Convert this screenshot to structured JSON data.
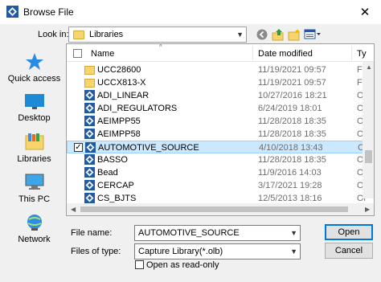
{
  "window": {
    "title": "Browse File",
    "close_glyph": "✕"
  },
  "toolbar": {
    "lookin_label": "Look in:",
    "lookin_value": "Libraries",
    "back_icon": "back-arrow-icon",
    "up_icon": "up-folder-icon",
    "newfolder_icon": "new-folder-icon",
    "views_icon": "views-menu-icon"
  },
  "places": [
    {
      "label": "Quick access",
      "icon": "star-icon"
    },
    {
      "label": "Desktop",
      "icon": "desktop-icon"
    },
    {
      "label": "Libraries",
      "icon": "libraries-icon"
    },
    {
      "label": "This PC",
      "icon": "computer-icon"
    },
    {
      "label": "Network",
      "icon": "network-icon"
    }
  ],
  "columns": {
    "name": "Name",
    "date": "Date modified",
    "type": "Ty"
  },
  "files": [
    {
      "name": "UCC28600",
      "date": "11/19/2021 09:57",
      "type": "Fil",
      "kind": "folder"
    },
    {
      "name": "UCCX813-X",
      "date": "11/19/2021 09:57",
      "type": "Fil",
      "kind": "folder"
    },
    {
      "name": "ADI_LINEAR",
      "date": "10/27/2016 18:21",
      "type": "Ol",
      "kind": "lib"
    },
    {
      "name": "ADI_REGULATORS",
      "date": "6/24/2019 18:01",
      "type": "Ol",
      "kind": "lib"
    },
    {
      "name": "AEIMPP55",
      "date": "11/28/2018 18:35",
      "type": "Ol",
      "kind": "lib"
    },
    {
      "name": "AEIMPP58",
      "date": "11/28/2018 18:35",
      "type": "Ol",
      "kind": "lib"
    },
    {
      "name": "AUTOMOTIVE_SOURCE",
      "date": "4/10/2018 13:43",
      "type": "Ol",
      "kind": "lib",
      "selected": true
    },
    {
      "name": "BASSO",
      "date": "11/28/2018 18:35",
      "type": "Ol",
      "kind": "lib"
    },
    {
      "name": "Bead",
      "date": "11/9/2016 14:03",
      "type": "Ol",
      "kind": "lib"
    },
    {
      "name": "CERCAP",
      "date": "3/17/2021 19:28",
      "type": "Ol",
      "kind": "lib"
    },
    {
      "name": "CS_BJTS",
      "date": "12/5/2013 18:16",
      "type": "Ol",
      "kind": "lib"
    }
  ],
  "bottom": {
    "filename_label": "File name:",
    "filename_value": "AUTOMOTIVE_SOURCE",
    "filetype_label": "Files of type:",
    "filetype_value": "Capture Library(*.olb)",
    "readonly_label": "Open as read-only",
    "open_label": "Open",
    "cancel_label": "Cancel"
  },
  "colors": {
    "selection_bg": "#cce8ff",
    "selection_border": "#99d1ff",
    "default_button_border": "#0078d7"
  }
}
